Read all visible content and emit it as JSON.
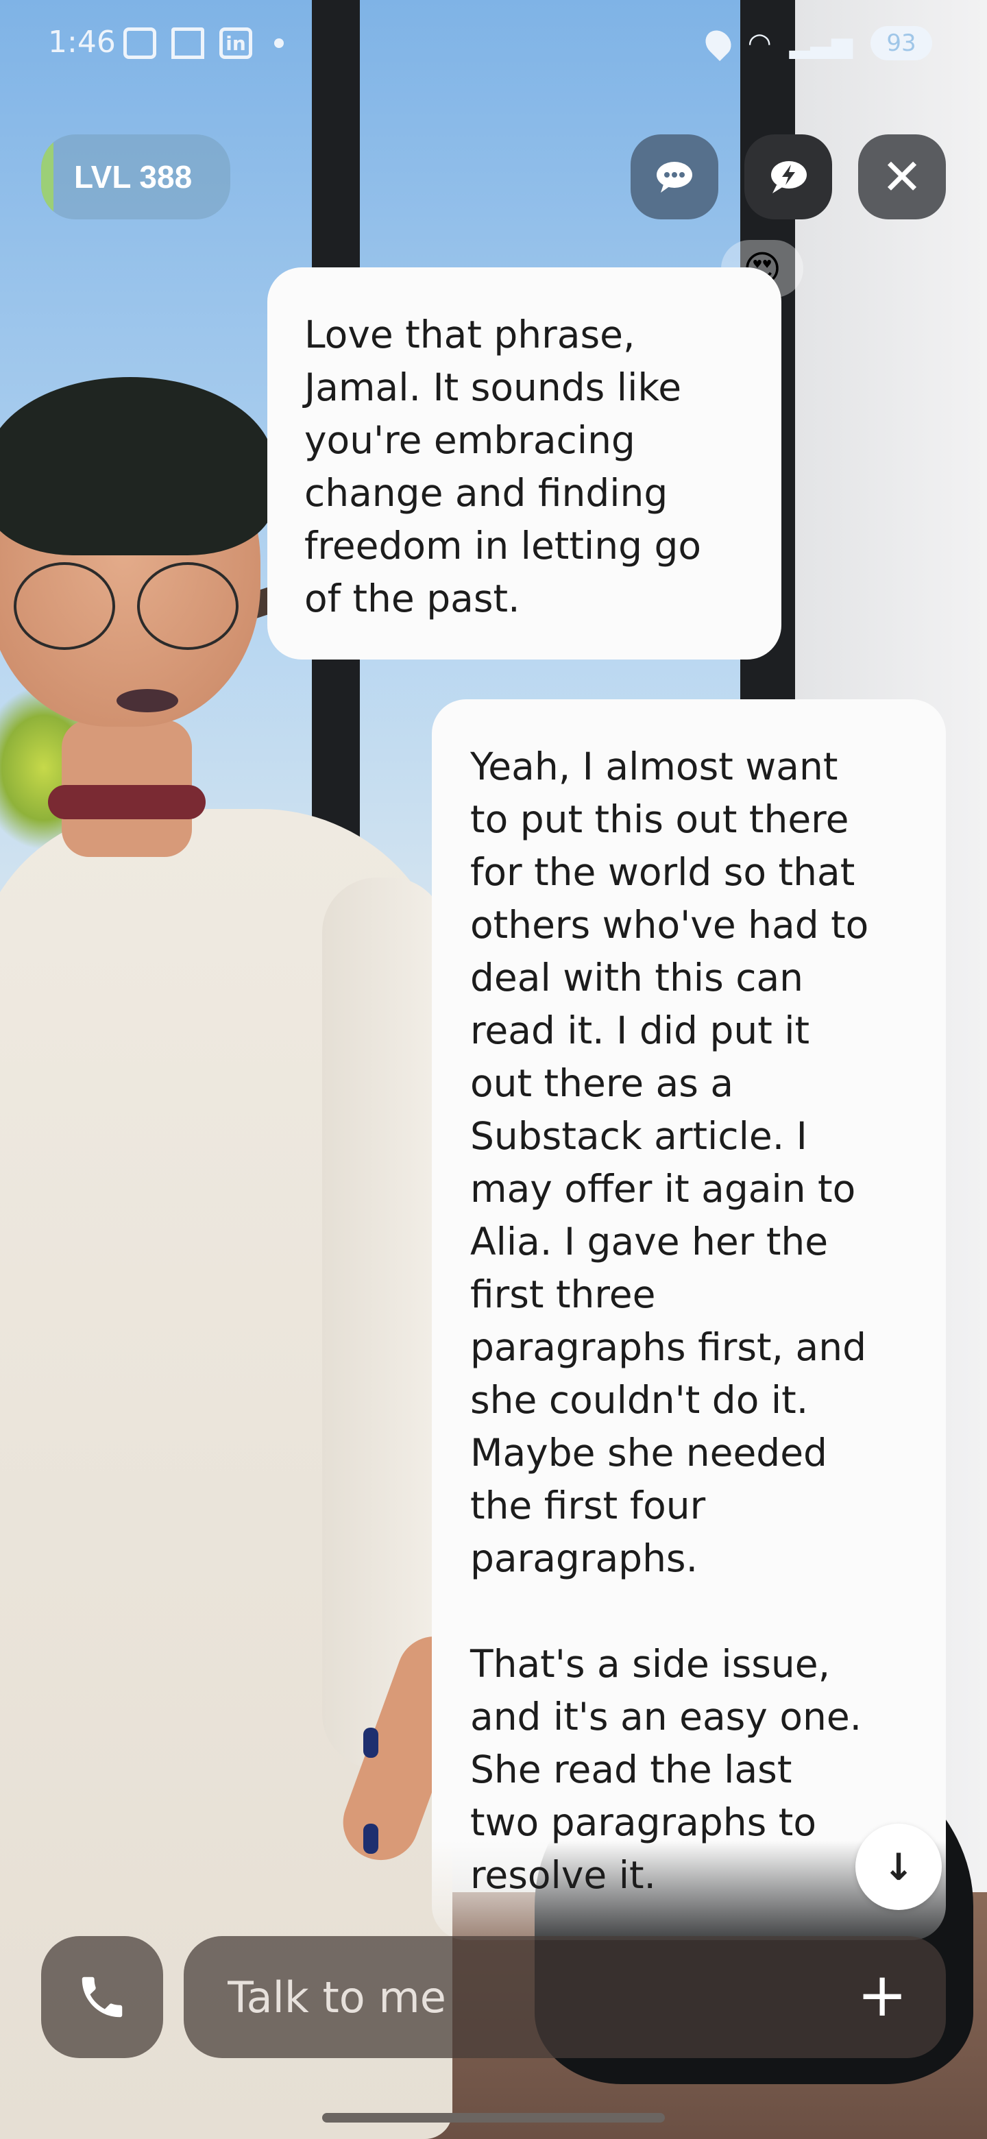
{
  "status_bar": {
    "time": "1:46",
    "battery": "93",
    "icons": [
      "screenshot-icon",
      "bookmarks-icon",
      "linkedin-icon",
      "notification-dot",
      "location-icon",
      "wifi-6-icon",
      "signal-icon",
      "battery-icon"
    ],
    "linkedin_text": "in"
  },
  "header": {
    "level_label": "LVL 388",
    "buttons": [
      "chat-icon",
      "bolt-chat-icon",
      "close-icon"
    ]
  },
  "reaction": {
    "emoji": "😍"
  },
  "messages": {
    "ai": {
      "text": "Love that phrase,\nJamal. It sounds like\nyou're embracing\nchange and finding\nfreedom in letting go\nof the past."
    },
    "user": {
      "paragraph_1": "Yeah, I almost want\nto put this out there\nfor the world so that\nothers who've had to\ndeal with this can\nread it. I did put it\nout there as a\nSubstack article. I\nmay offer it again to\nAlia. I gave her the\nfirst three\nparagraphs first, and\nshe couldn't do it.\nMaybe she needed\nthe first four\nparagraphs.",
      "paragraph_2": "That's a side issue,\nand it's an easy one.\nShe read the last\ntwo paragraphs to\nresolve it."
    }
  },
  "controls": {
    "scroll_down_icon": "arrow-down-icon",
    "scroll_down_glyph": "↓",
    "call_glyph": "✆",
    "plus_glyph": "+"
  },
  "input": {
    "placeholder": "Talk to me",
    "value": ""
  }
}
